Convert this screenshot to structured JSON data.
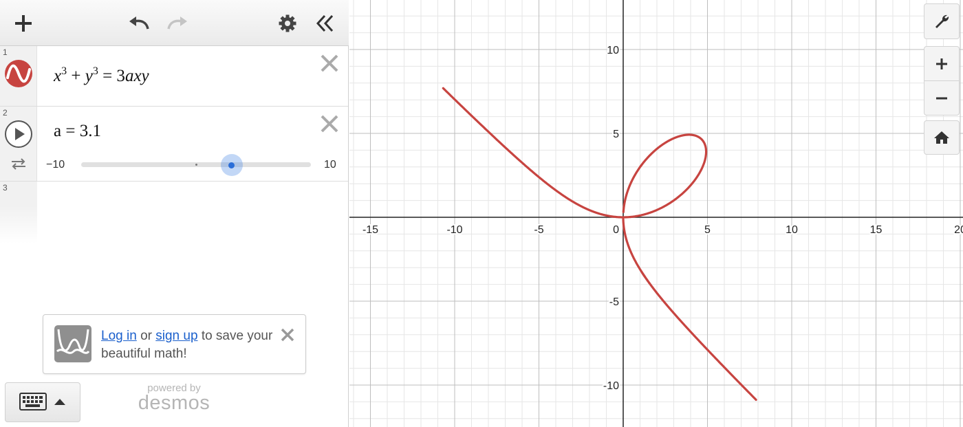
{
  "toolbar": {
    "add_icon": "plus-icon",
    "undo_icon": "undo-icon",
    "redo_icon": "redo-icon",
    "settings_icon": "gear-icon",
    "collapse_icon": "double-chevron-left-icon"
  },
  "expressions": [
    {
      "index": "1",
      "latex": "x^3 + y^3 = 3axy",
      "color": "#c74440",
      "icon": "wave-icon"
    },
    {
      "index": "2",
      "latex": "a = 3.1",
      "slider": {
        "min_label": "−10",
        "max_label": "10",
        "min": -10,
        "max": 10,
        "value": 3.1
      },
      "icons": [
        "play-icon",
        "loop-icon"
      ]
    },
    {
      "index": "3",
      "latex": ""
    }
  ],
  "login_card": {
    "login_link": "Log in",
    "or_text": "or",
    "signup_link": "sign up",
    "rest_text": "to save your beautiful math!"
  },
  "footer": {
    "powered_by": "powered by",
    "brand": "desmos"
  },
  "graph": {
    "x_ticks": [
      "-15",
      "-10",
      "-5",
      "0",
      "5",
      "10",
      "15",
      "20"
    ],
    "y_ticks": [
      "10",
      "5",
      "-5",
      "-10"
    ],
    "curve_color": "#c74440",
    "a": 3.1,
    "buttons": [
      "wrench-icon",
      "zoom-in-icon",
      "zoom-out-icon",
      "home-icon"
    ]
  }
}
